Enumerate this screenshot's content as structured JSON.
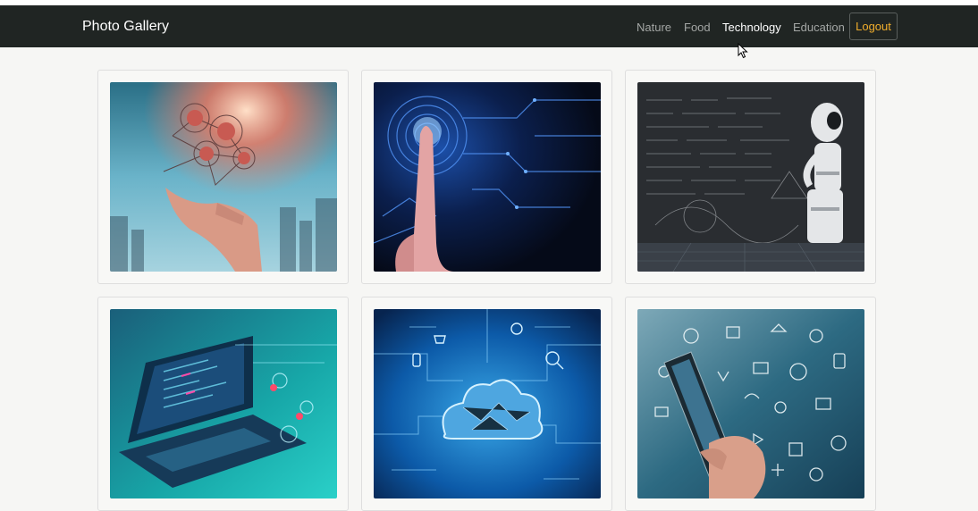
{
  "navbar": {
    "brand": "Photo Gallery",
    "links": [
      {
        "label": "Nature",
        "active": false
      },
      {
        "label": "Food",
        "active": false
      },
      {
        "label": "Technology",
        "active": true
      },
      {
        "label": "Education",
        "active": false
      }
    ],
    "logout_label": "Logout",
    "colors": {
      "background": "#202523",
      "logout_accent": "#f0ad2c"
    }
  },
  "gallery": {
    "category": "Technology",
    "items": [
      {
        "image": "hand-with-gears-network-image"
      },
      {
        "image": "finger-touching-fingerprint-image"
      },
      {
        "image": "robot-with-math-chalkboard-image"
      },
      {
        "image": "laptop-with-code-image"
      },
      {
        "image": "cloud-computing-network-image"
      },
      {
        "image": "phone-with-doodle-icons-image"
      }
    ]
  }
}
